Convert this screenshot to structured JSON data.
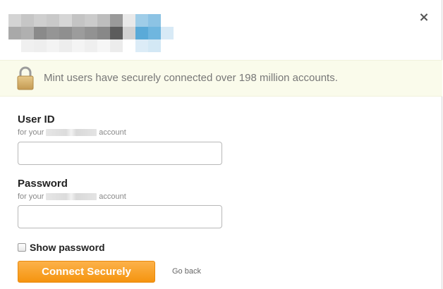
{
  "dialog": {
    "close_label": "×",
    "close_icon": "close-icon"
  },
  "banner": {
    "icon": "lock-icon",
    "text": "Mint users have securely connected over 198 million accounts."
  },
  "user_id": {
    "label": "User ID",
    "sub_prefix": "for your",
    "sub_suffix": "account",
    "value": ""
  },
  "password": {
    "label": "Password",
    "sub_prefix": "for your",
    "sub_suffix": "account",
    "value": ""
  },
  "show_password": {
    "label": "Show password",
    "checked": false
  },
  "actions": {
    "connect_label": "Connect Securely",
    "go_back_label": "Go back"
  },
  "colors": {
    "accent": "#f5940f",
    "banner_bg": "#fafbeb"
  }
}
